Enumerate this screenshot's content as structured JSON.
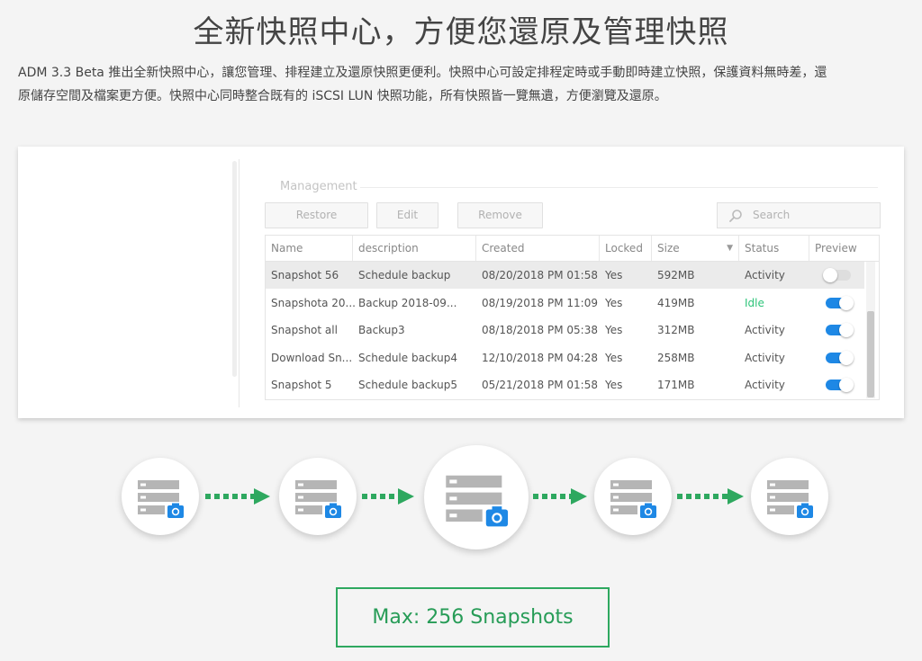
{
  "headline": "全新快照中心，方便您還原及管理快照",
  "intro": {
    "line1": "ADM 3.3 Beta 推出全新快照中心，讓您管理、排程建立及還原快照更便利。快照中心可設定排程定時或手動即時建立快照，保護資料無時差，還",
    "line2": "原儲存空間及檔案更方便。快照中心同時整合既有的 iSCSI LUN 快照功能，所有快照皆一覽無遺，方便瀏覽及還原。"
  },
  "panel": {
    "section_title": "Management",
    "buttons": {
      "restore": "Restore",
      "edit": "Edit",
      "remove": "Remove"
    },
    "search_placeholder": "Search",
    "columns": {
      "name": "Name",
      "description": "description",
      "created": "Created",
      "locked": "Locked",
      "size": "Size",
      "status": "Status",
      "preview": "Preview"
    },
    "rows": [
      {
        "name": "Snapshot 56",
        "description": "Schedule backup",
        "created": "08/20/2018 PM 01:58",
        "locked": "Yes",
        "size": "592MB",
        "status": "Activity",
        "preview": false,
        "selected": true
      },
      {
        "name": "Snapshota 20...",
        "description": "Backup 2018-09...",
        "created": "08/19/2018 PM 11:09",
        "locked": "Yes",
        "size": "419MB",
        "status": "Idle",
        "preview": true,
        "selected": false
      },
      {
        "name": "Snapshot all",
        "description": "Backup3",
        "created": "08/18/2018 PM 05:38",
        "locked": "Yes",
        "size": "312MB",
        "status": "Activity",
        "preview": true,
        "selected": false
      },
      {
        "name": "Download Sn...",
        "description": "Schedule backup4",
        "created": "12/10/2018 PM 04:28",
        "locked": "Yes",
        "size": "258MB",
        "status": "Activity",
        "preview": true,
        "selected": false
      },
      {
        "name": "Snapshot 5",
        "description": "Schedule backup5",
        "created": "05/21/2018 PM 01:58",
        "locked": "Yes",
        "size": "171MB",
        "status": "Activity",
        "preview": true,
        "selected": false
      }
    ]
  },
  "diagram": {
    "nodes": [
      "server-camera-icon",
      "server-camera-icon",
      "server-camera-icon",
      "server-camera-icon",
      "server-camera-icon"
    ],
    "max_label": "Max: 256 Snapshots"
  },
  "colors": {
    "accent_green": "#2ea85f",
    "toggle_blue": "#1e88e5",
    "idle_green": "#2ec47a",
    "camera_blue": "#1e88e5",
    "server_gray": "#b5b5b5"
  }
}
